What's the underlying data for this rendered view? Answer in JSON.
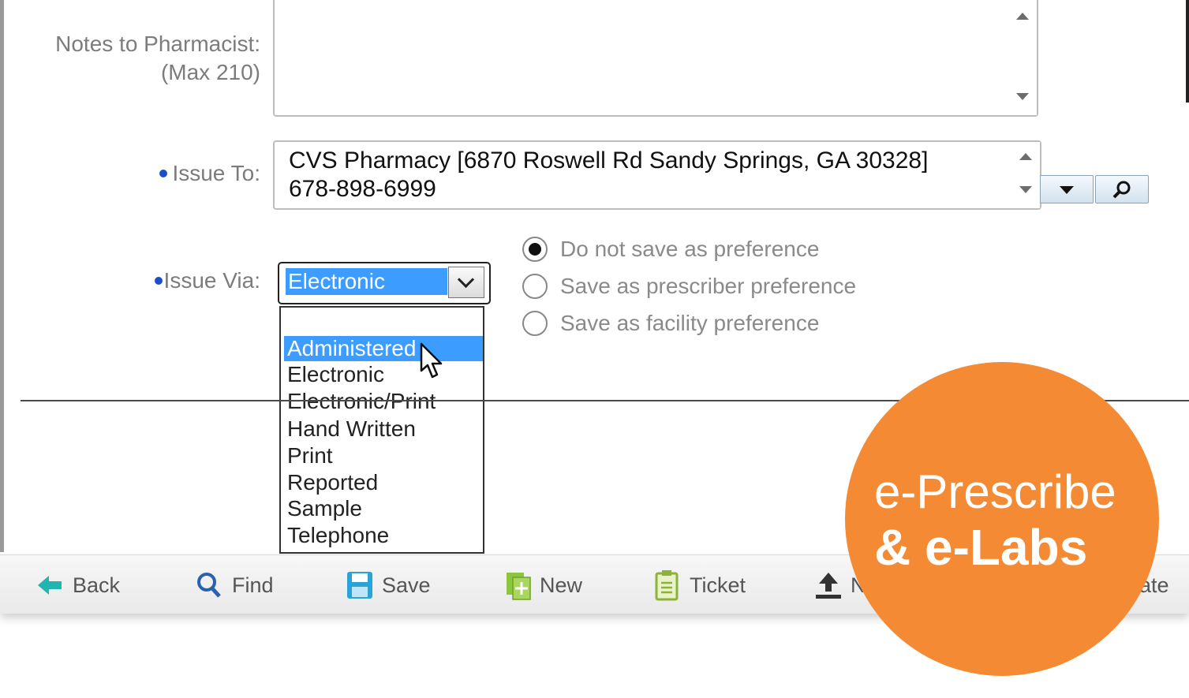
{
  "form": {
    "notes_label_line1": "Notes to Pharmacist:",
    "notes_label_line2": "(Max 210)",
    "notes_value": "",
    "issue_to_label": "Issue To:",
    "issue_to_line1": "CVS Pharmacy [6870 Roswell Rd Sandy Springs, GA 30328]",
    "issue_to_line2": "678-898-6999",
    "issue_via_label": "Issue Via:",
    "issue_via_selected": "Electronic",
    "issue_via_options": [
      "Administered",
      "Electronic",
      "Electronic/Print",
      "Hand Written",
      "Print",
      "Reported",
      "Sample",
      "Telephone"
    ],
    "highlighted_option": "Administered"
  },
  "preference": {
    "options": [
      "Do not save as preference",
      "Save as prescriber preference",
      "Save as facility preference"
    ],
    "selected": "Do not save as preference"
  },
  "toolbar": {
    "back": "Back",
    "find": "Find",
    "save": "Save",
    "new": "New",
    "ticket": "Ticket",
    "partial_a": "N",
    "partial_b": "ate"
  },
  "badge": {
    "line1": "e-Prescribe",
    "line2": "& e-Labs",
    "color": "#f48a33"
  },
  "colors": {
    "selection": "#3c9cff",
    "required_bullet": "#1b4fc9"
  },
  "icons": [
    "back-arrow-icon",
    "search-icon",
    "save-disk-icon",
    "new-document-icon",
    "clipboard-icon",
    "upload-icon",
    "dropdown-arrow-icon",
    "magnifier-icon",
    "chevron-down-icon",
    "mouse-cursor-icon"
  ]
}
